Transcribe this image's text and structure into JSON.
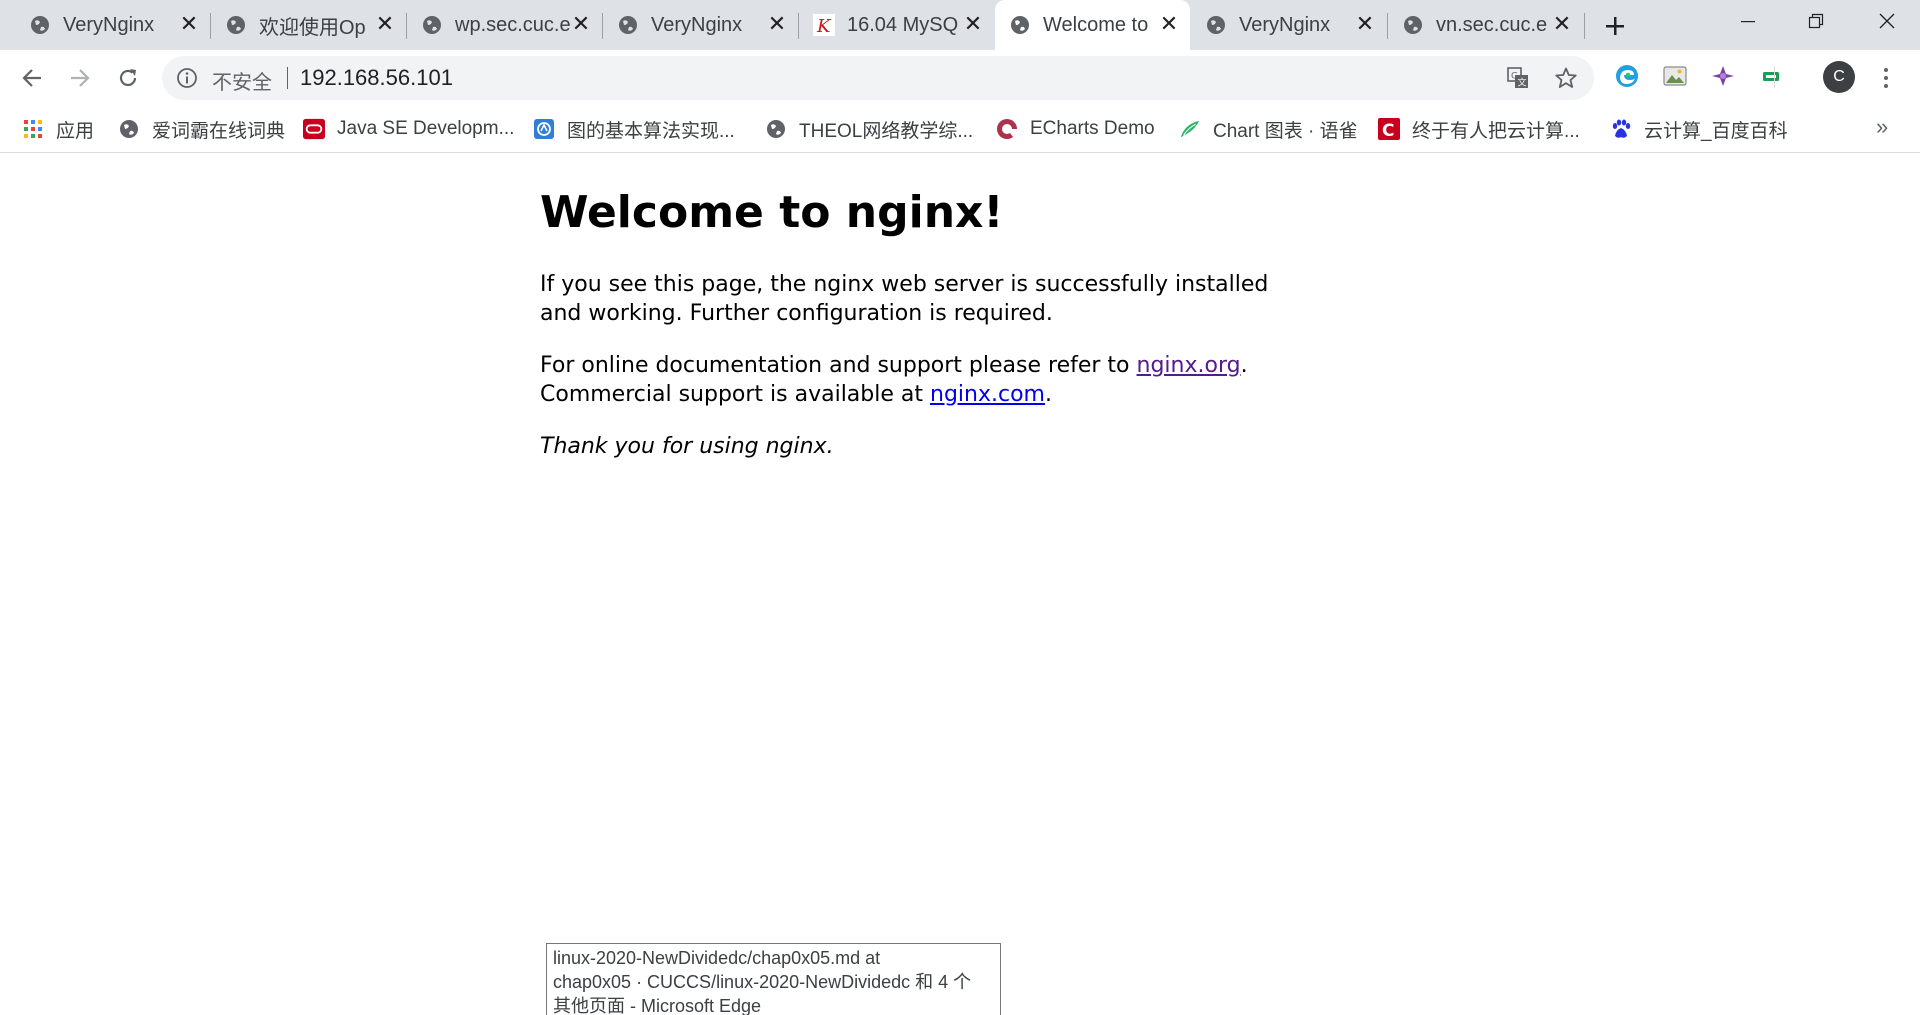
{
  "tabs": [
    {
      "title": "VeryNginx",
      "favicon": "globe-icon",
      "active": false
    },
    {
      "title": "欢迎使用Op",
      "favicon": "globe-icon",
      "active": false
    },
    {
      "title": "wp.sec.cuc.e",
      "favicon": "globe-icon",
      "active": false
    },
    {
      "title": "VeryNginx",
      "favicon": "globe-icon",
      "active": false
    },
    {
      "title": "16.04 MySQ",
      "favicon": "k-logo-icon",
      "active": false
    },
    {
      "title": "Welcome to",
      "favicon": "globe-icon",
      "active": true
    },
    {
      "title": "VeryNginx",
      "favicon": "globe-icon",
      "active": false
    },
    {
      "title": "vn.sec.cuc.e",
      "favicon": "globe-icon",
      "active": false
    }
  ],
  "toolbar": {
    "security_label": "不安全",
    "url": "192.168.56.101",
    "avatar_letter": "C"
  },
  "bookmarks": [
    {
      "label": "应用",
      "icon": "apps-grid-icon"
    },
    {
      "label": "爱词霸在线词典",
      "icon": "globe-icon"
    },
    {
      "label": "Java SE Developm...",
      "icon": "oracle-icon"
    },
    {
      "label": "图的基本算法实现...",
      "icon": "book-icon"
    },
    {
      "label": "THEOL网络教学综...",
      "icon": "globe-icon"
    },
    {
      "label": "ECharts Demo",
      "icon": "echarts-icon"
    },
    {
      "label": "Chart 图表 · 语雀",
      "icon": "yuque-icon"
    },
    {
      "label": "终于有人把云计算...",
      "icon": "csdn-icon"
    },
    {
      "label": "云计算_百度百科",
      "icon": "baidu-icon"
    }
  ],
  "page": {
    "heading": "Welcome to nginx!",
    "para1": "If you see this page, the nginx web server is successfully installed and working. Further configuration is required.",
    "para2_prefix": "For online documentation and support please refer to ",
    "link_org": "nginx.org",
    "para2_mid": ".",
    "para2_line2": "Commercial support is available at ",
    "link_com": "nginx.com",
    "para2_end": ".",
    "thanks": "Thank you for using nginx."
  },
  "tooltip": {
    "line1": "linux-2020-NewDividedc/chap0x05.md at",
    "line2": "chap0x05 · CUCCS/linux-2020-NewDividedc 和 4 个",
    "line3": "其他页面 - Microsoft Edge"
  },
  "colors": {
    "tabstrip": "#dee1e6",
    "link_visited": "#551a8b",
    "link_new": "#0000ee"
  }
}
